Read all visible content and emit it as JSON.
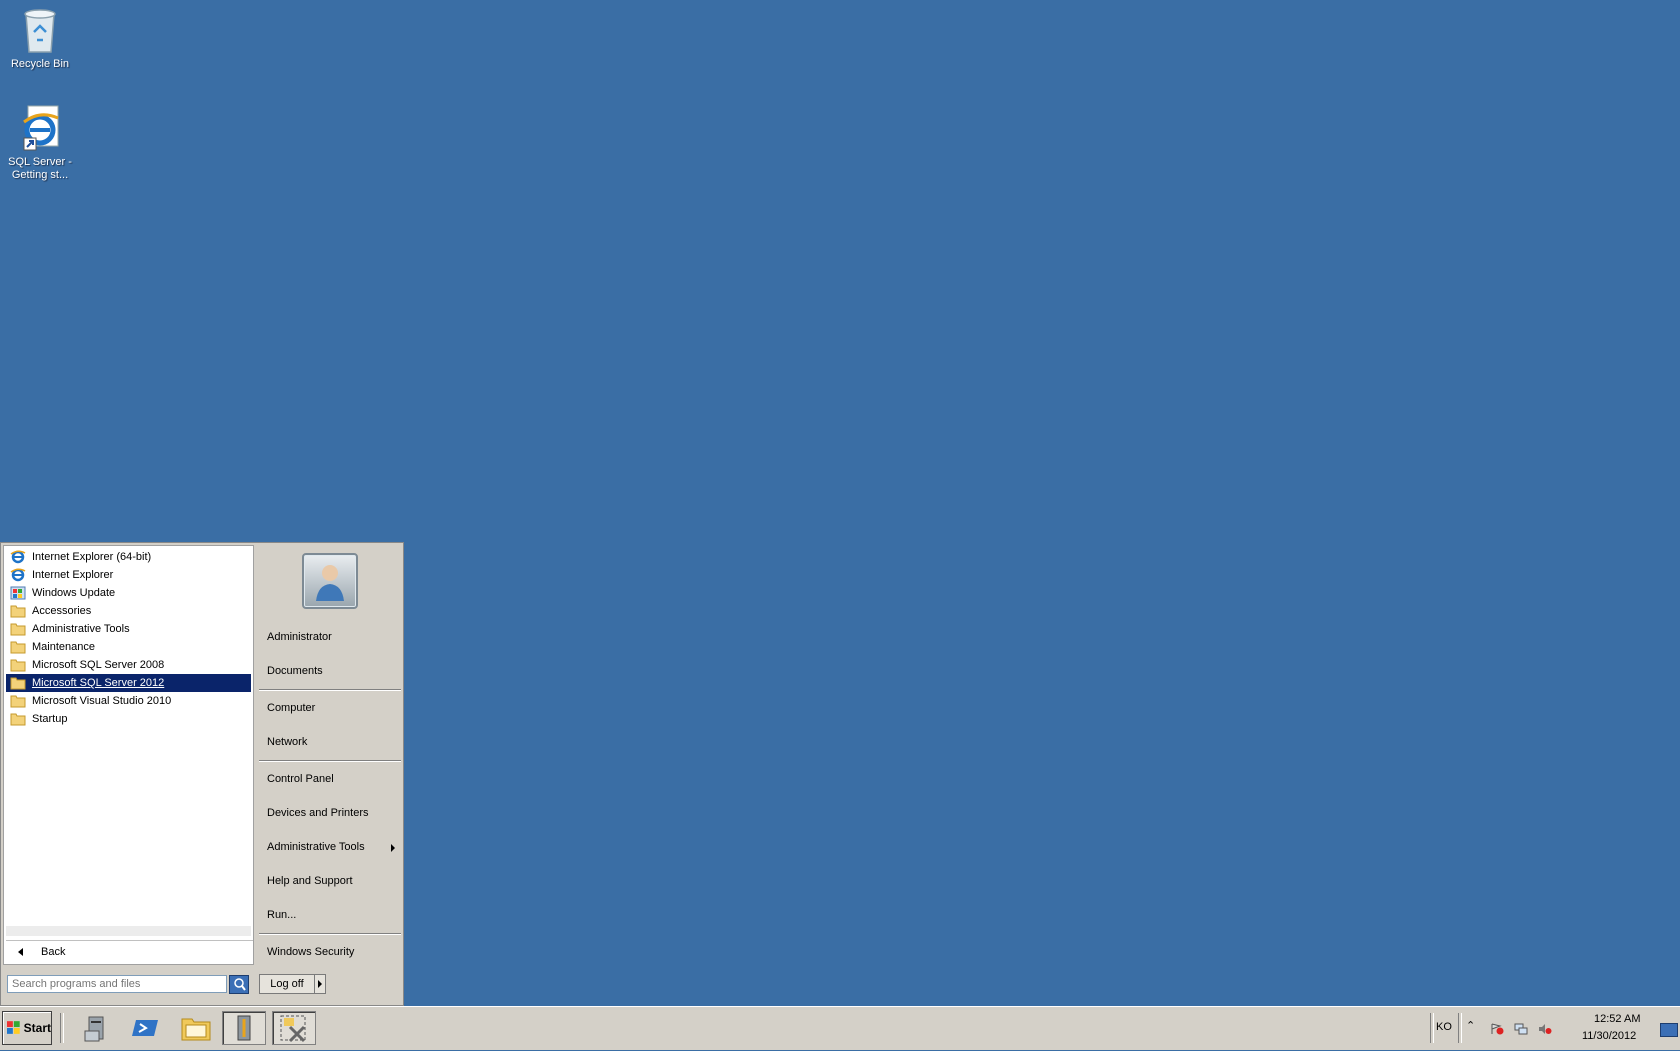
{
  "desktop": {
    "icons": [
      {
        "label": "Recycle Bin",
        "icon": "recycle-bin-icon"
      },
      {
        "label": "SQL Server - Getting st...",
        "icon": "internet-explorer-shortcut-icon"
      }
    ]
  },
  "start_menu": {
    "programs": [
      {
        "label": "Internet Explorer (64-bit)",
        "icon": "internet-explorer-icon"
      },
      {
        "label": "Internet Explorer",
        "icon": "internet-explorer-icon"
      },
      {
        "label": "Windows Update",
        "icon": "windows-update-icon"
      },
      {
        "label": "Accessories",
        "icon": "folder-icon"
      },
      {
        "label": "Administrative Tools",
        "icon": "folder-icon"
      },
      {
        "label": "Maintenance",
        "icon": "folder-icon"
      },
      {
        "label": "Microsoft SQL Server 2008",
        "icon": "folder-icon"
      },
      {
        "label": "Microsoft SQL Server 2012",
        "icon": "folder-icon",
        "selected": true
      },
      {
        "label": "Microsoft Visual Studio 2010",
        "icon": "folder-icon"
      },
      {
        "label": "Startup",
        "icon": "folder-icon"
      }
    ],
    "back_label": "Back",
    "right_items": {
      "administrator": "Administrator",
      "documents": "Documents",
      "computer": "Computer",
      "network": "Network",
      "control_panel": "Control Panel",
      "devices_printers": "Devices and Printers",
      "admin_tools": "Administrative Tools",
      "help_support": "Help and Support",
      "run": "Run...",
      "windows_security": "Windows Security"
    },
    "search_placeholder": "Search programs and files",
    "logoff_label": "Log off"
  },
  "taskbar": {
    "start_label": "Start",
    "pinned": [
      {
        "icon": "server-manager-icon"
      },
      {
        "icon": "powershell-icon"
      },
      {
        "icon": "explorer-folder-icon"
      },
      {
        "icon": "sql-config-tool-icon"
      },
      {
        "icon": "admin-tools-icon",
        "active": true
      }
    ],
    "language": "KO",
    "clock_time": "12:52 AM",
    "clock_date": "11/30/2012"
  },
  "colors": {
    "desktop": "#3a6ea5",
    "selection": "#0a246a",
    "chrome": "#d4d0c8"
  }
}
